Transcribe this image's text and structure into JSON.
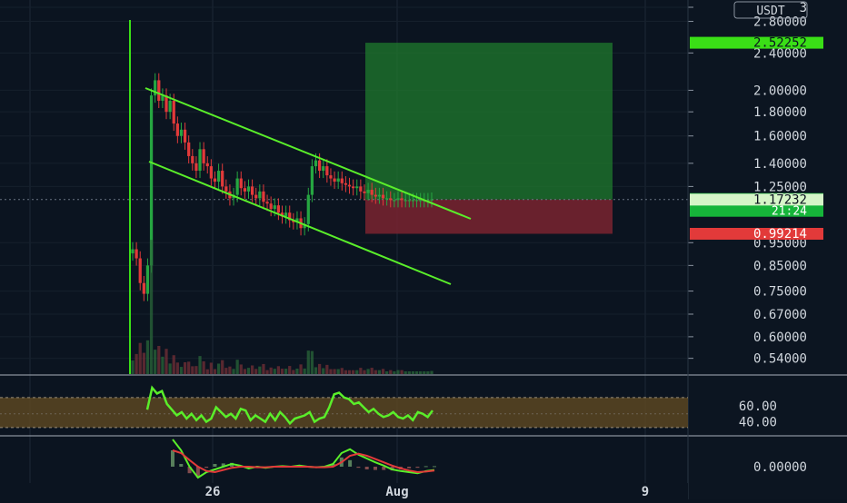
{
  "chart_data": [
    {
      "type": "line",
      "panel": "price",
      "quote_currency": "USDT",
      "price_scale": "log",
      "ylim": [
        0.5,
        3.0
      ],
      "y_ticks": [
        "3",
        "2.80000",
        "2.40000",
        "2.00000",
        "1.80000",
        "1.60000",
        "1.40000",
        "1.25000",
        "0.95000",
        "0.85000",
        "0.75000",
        "0.67000",
        "0.60000",
        "0.54000"
      ],
      "x_ticks": [
        "26",
        "Aug",
        "9"
      ],
      "grid": true,
      "series": [
        {
          "x": [
            0,
            1,
            2,
            3,
            4,
            5,
            6,
            7,
            8,
            9,
            10,
            11,
            12,
            13,
            14,
            15,
            16,
            17,
            18,
            19,
            20,
            21,
            22,
            23,
            24,
            25,
            26,
            27,
            28,
            29,
            30,
            31,
            32,
            33,
            34,
            35,
            36,
            37,
            38,
            39,
            40,
            41,
            42,
            43,
            44,
            45,
            46,
            47,
            48,
            49,
            50,
            51,
            52,
            53,
            54,
            55,
            56,
            57,
            58,
            59,
            60,
            61,
            62,
            63,
            64,
            65,
            66,
            67,
            68,
            69,
            70,
            71,
            72,
            73,
            74,
            75,
            76,
            77,
            78,
            79,
            80
          ],
          "values": [
            0.92,
            0.88,
            0.78,
            0.74,
            0.85,
            1.95,
            2.1,
            1.9,
            1.95,
            1.8,
            1.9,
            1.7,
            1.6,
            1.65,
            1.55,
            1.45,
            1.4,
            1.35,
            1.5,
            1.4,
            1.38,
            1.3,
            1.28,
            1.35,
            1.25,
            1.22,
            1.18,
            1.2,
            1.3,
            1.24,
            1.22,
            1.25,
            1.2,
            1.18,
            1.22,
            1.16,
            1.15,
            1.12,
            1.14,
            1.1,
            1.08,
            1.1,
            1.06,
            1.05,
            1.07,
            1.02,
            1.04,
            1.2,
            1.38,
            1.42,
            1.35,
            1.38,
            1.32,
            1.3,
            1.28,
            1.3,
            1.27,
            1.26,
            1.25,
            1.24,
            1.25,
            1.22,
            1.21,
            1.23,
            1.2,
            1.19,
            1.2,
            1.18,
            1.18,
            1.17,
            1.17,
            1.18,
            1.17,
            1.17,
            1.17,
            1.17,
            1.17,
            1.17,
            1.17,
            1.17,
            1.17313
          ]
        }
      ],
      "price_labels": [
        {
          "label": "2.52252",
          "value": 2.52252,
          "color": "#3adf16",
          "text_color": "#0b1420"
        },
        {
          "label": "1.17313",
          "sublabel": "21:24",
          "value": 1.17313,
          "color": "#16b53a",
          "text_color": "#ffffff"
        },
        {
          "label": "1.17232",
          "value": 1.17232,
          "color": "#d6f5c8",
          "text_color": "#0b1420"
        },
        {
          "label": "0.99214",
          "value": 0.99214,
          "color": "#e23a3a",
          "text_color": "#ffffff"
        }
      ],
      "position": {
        "take_profit": 2.52252,
        "entry": 1.17232,
        "stop": 0.99214
      },
      "colors": {
        "up": "#26a641",
        "down": "#e23a3a",
        "channel": "#5aee2a",
        "profit_zone": "#1f7a2c",
        "loss_zone": "#7a2330"
      }
    },
    {
      "type": "line",
      "panel": "oscillator",
      "y_ticks": [
        "60.00",
        "40.00"
      ],
      "band": [
        33,
        70
      ],
      "series": [
        {
          "values": [
            55,
            82,
            75,
            78,
            62,
            55,
            48,
            52,
            44,
            50,
            42,
            48,
            40,
            44,
            58,
            52,
            46,
            50,
            44,
            56,
            54,
            42,
            48,
            44,
            40,
            50,
            42,
            52,
            46,
            38,
            44,
            46,
            48,
            52,
            40,
            44,
            46,
            58,
            74,
            76,
            70,
            68,
            62,
            64,
            58,
            52,
            56,
            50,
            46,
            48,
            52,
            46,
            44,
            48,
            42,
            52,
            50,
            46,
            54
          ]
        }
      ],
      "colors": {
        "line": "#5aee2a",
        "band": "#5b4522"
      }
    },
    {
      "type": "line",
      "panel": "macd",
      "y_ticks": [
        "0.00000"
      ],
      "series": [
        {
          "values": [
            0.6,
            0.3,
            0.0,
            -0.2,
            -0.1,
            -0.05,
            0.0,
            0.05,
            0.02,
            -0.03,
            0.0,
            -0.02,
            0.0,
            0.01,
            0.0,
            0.02,
            0.0,
            -0.01,
            0.0,
            0.05,
            0.25,
            0.32,
            0.22,
            0.15,
            0.08,
            0.02,
            -0.05,
            -0.08,
            -0.1,
            -0.12,
            -0.08,
            -0.06
          ],
          "color": "#5aee2a"
        },
        {
          "values": [
            0.3,
            0.25,
            0.12,
            0.0,
            -0.08,
            -0.1,
            -0.06,
            -0.02,
            0.0,
            0.0,
            -0.01,
            -0.01,
            0.0,
            0.0,
            0.0,
            0.0,
            0.0,
            -0.01,
            -0.01,
            0.0,
            0.08,
            0.2,
            0.24,
            0.2,
            0.14,
            0.08,
            0.02,
            -0.03,
            -0.07,
            -0.1,
            -0.09,
            -0.07
          ],
          "color": "#e23a3a"
        }
      ]
    }
  ]
}
